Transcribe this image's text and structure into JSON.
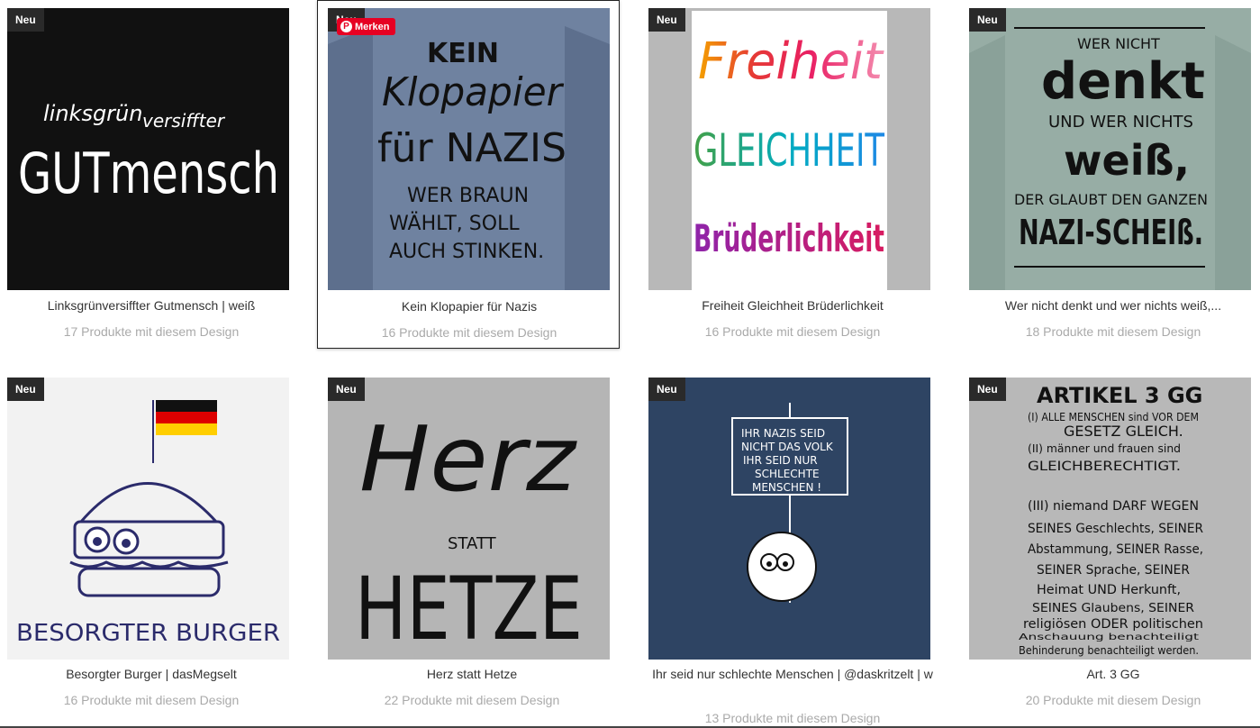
{
  "badge_label": "Neu",
  "pin_label": "Merken",
  "products": [
    {
      "title": "Linksgrünversiffter Gutmensch | weiß",
      "count": "17 Produkte mit diesem Design"
    },
    {
      "title": "Kein Klopapier für Nazis",
      "count": "16 Produkte mit diesem Design"
    },
    {
      "title": "Freiheit Gleichheit Brüderlichkeit",
      "count": "16 Produkte mit diesem Design"
    },
    {
      "title": "Wer nicht denkt und wer nichts weiß,...",
      "count": "18 Produkte mit diesem Design"
    },
    {
      "title": "Besorgter Burger | dasMegselt",
      "count": "16 Produkte mit diesem Design"
    },
    {
      "title": "Herz statt Hetze",
      "count": "22 Produkte mit diesem Design"
    },
    {
      "title": "Ihr seid nur schlechte Menschen | @daskritzelt | w",
      "count": "13 Produkte mit diesem Design"
    },
    {
      "title": "Art. 3 GG",
      "count": "20 Produkte mit diesem Design"
    }
  ],
  "designs": {
    "d0": {
      "line1": "linksgrün",
      "line2": "versiffter",
      "line3": "GUTmensch"
    },
    "d1": {
      "line1": "KEIN",
      "line2": "Klopapier",
      "line3": "für NAZIS",
      "line4": "WER BRAUN",
      "line5": "WÄHLT, SOLL",
      "line6": "AUCH STINKEN."
    },
    "d2": {
      "line1": "Freiheit",
      "line2": "GLEICHHEIT",
      "line3": "Brüderlichkeit"
    },
    "d3": {
      "line1": "WER NICHT",
      "line2": "denkt",
      "line3": "UND WER NICHTS",
      "line4": "weiß,",
      "line5": "DER GLAUBT DEN GANZEN",
      "line6": "NAZI-SCHEIß."
    },
    "d4": {
      "line1": "BESORGTER BURGER"
    },
    "d5": {
      "line1": "Herz",
      "line2": "STATT",
      "line3": "HETZE"
    },
    "d6": {
      "line1": "IHR NAZIS SEID",
      "line2": "NICHT DAS VOLK",
      "line3": "IHR SEID NUR",
      "line4": "SCHLECHTE",
      "line5": "MENSCHEN !"
    },
    "d7": {
      "line1": "ARTIKEL 3 GG",
      "line2": "(I) ALLE MENSCHEN sind VOR DEM",
      "line3": "GESETZ GLEICH.",
      "line4": "(II) männer und frauen sind",
      "line5": "GLEICHBERECHTIGT.",
      "line6": "(III) niemand DARF WEGEN",
      "line7": "SEINES Geschlechts, SEINER",
      "line8": "Abstammung, SEINER Rasse,",
      "line9": "SEINER Sprache, SEINER",
      "line10": "Heimat UND Herkunft,",
      "line11": "SEINES Glaubens, SEINER",
      "line12": "religiösen ODER politischen",
      "line13": "Anschauung benachteiligt",
      "line14": "Behinderung benachteiligt werden."
    }
  },
  "colors": {
    "badge_bg": "#2a2a2a",
    "pin_red": "#e60023",
    "muted_text": "#aaaaaa"
  }
}
